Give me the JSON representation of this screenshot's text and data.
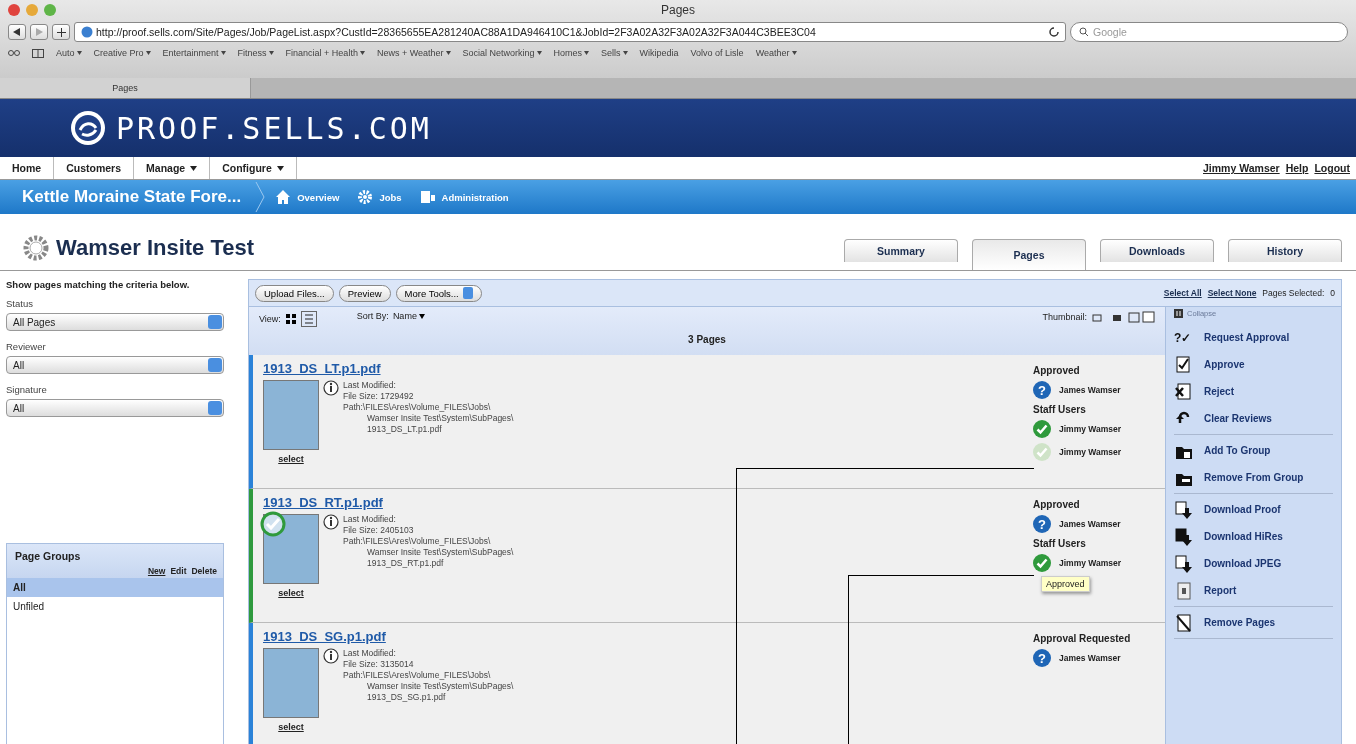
{
  "browser": {
    "title": "Pages",
    "url": "http://proof.sells.com/Site/Pages/Job/PageList.aspx?CustId=28365655EA281240AC88A1DA946410C1&JobId=2F3A02A32F3A02A32F3A044C3BEE3C04",
    "search_placeholder": "Google",
    "bookmarks": [
      {
        "label": "Auto",
        "dropdown": true
      },
      {
        "label": "Creative Pro",
        "dropdown": true
      },
      {
        "label": "Entertainment",
        "dropdown": true
      },
      {
        "label": "Fitness",
        "dropdown": true
      },
      {
        "label": "Financial + Health",
        "dropdown": true
      },
      {
        "label": "News + Weather",
        "dropdown": true
      },
      {
        "label": "Social Networking",
        "dropdown": true
      },
      {
        "label": "Homes",
        "dropdown": true
      },
      {
        "label": "Sells",
        "dropdown": true
      },
      {
        "label": "Wikipedia",
        "dropdown": false
      },
      {
        "label": "Volvo of Lisle",
        "dropdown": false
      },
      {
        "label": "Weather",
        "dropdown": true
      }
    ],
    "tab": "Pages"
  },
  "site": {
    "logo": "PROOF.SELLS.COM"
  },
  "menu": {
    "items": [
      {
        "label": "Home",
        "dropdown": false
      },
      {
        "label": "Customers",
        "dropdown": false
      },
      {
        "label": "Manage",
        "dropdown": true
      },
      {
        "label": "Configure",
        "dropdown": true
      }
    ],
    "user": "Jimmy Wamser",
    "links": [
      "Help",
      "Logout"
    ]
  },
  "breadcrumb": {
    "job": "Kettle Moraine State Fore...",
    "links": [
      {
        "label": "Overview",
        "kind": "home"
      },
      {
        "label": "Jobs",
        "kind": "gear"
      },
      {
        "label": "Administration",
        "kind": "admin"
      }
    ]
  },
  "page_title": "Wamser Insite Test",
  "tabs": [
    {
      "label": "Summary",
      "selected": false
    },
    {
      "label": "Pages",
      "selected": true
    },
    {
      "label": "Downloads",
      "selected": false
    },
    {
      "label": "History",
      "selected": false
    }
  ],
  "filters": {
    "intro": "Show pages matching the criteria below.",
    "fields": [
      {
        "label": "Status",
        "value": "All Pages"
      },
      {
        "label": "Reviewer",
        "value": "All"
      },
      {
        "label": "Signature",
        "value": "All"
      }
    ]
  },
  "page_groups": {
    "title": "Page Groups",
    "actions": [
      "New",
      "Edit",
      "Delete"
    ],
    "items": [
      {
        "label": "All",
        "selected": true
      },
      {
        "label": "Unfiled",
        "selected": false
      }
    ]
  },
  "toolbar": {
    "buttons": [
      "Upload Files...",
      "Preview"
    ],
    "more_tools": "More Tools...",
    "select_links": [
      "Select All",
      "Select None"
    ],
    "selected_label": "Pages Selected:",
    "selected_count": "0"
  },
  "view": {
    "label": "View:",
    "sort_label": "Sort By:",
    "sort_value": "Name",
    "thumbnail_label": "Thumbnail:",
    "count": "3 Pages"
  },
  "pages": [
    {
      "name": "1913_DS_LT.p1.pdf",
      "color": "#2a82d8",
      "approved_badge": false,
      "info": [
        "Last Modified:",
        "File Size: 1729492",
        "Path:\\FILES\\Ares\\Volume_FILES\\Jobs\\",
        "Wamser Insite Test\\System\\SubPages\\",
        "1913_DS_LT.p1.pdf"
      ],
      "select": "select",
      "sections": [
        {
          "heading": "Approved",
          "reviewers": [
            {
              "name": "James Wamser",
              "kind": "pending",
              "icon": "?"
            }
          ]
        },
        {
          "heading": "Staff Users",
          "reviewers": [
            {
              "name": "Jimmy Wamser",
              "kind": "approved"
            },
            {
              "name": "Jimmy Wamser",
              "kind": "faded"
            }
          ]
        }
      ]
    },
    {
      "name": "1913_DS_RT.p1.pdf",
      "color": "#2e9a3e",
      "approved_badge": true,
      "info": [
        "Last Modified:",
        "File Size: 2405103",
        "Path:\\FILES\\Ares\\Volume_FILES\\Jobs\\",
        "Wamser Insite Test\\System\\SubPages\\",
        "1913_DS_RT.p1.pdf"
      ],
      "select": "select",
      "sections": [
        {
          "heading": "Approved",
          "reviewers": [
            {
              "name": "James Wamser",
              "kind": "pending",
              "icon": "?"
            }
          ]
        },
        {
          "heading": "Staff Users",
          "reviewers": [
            {
              "name": "Jimmy Wamser",
              "kind": "approved",
              "tooltip": "Approved"
            }
          ]
        }
      ]
    },
    {
      "name": "1913_DS_SG.p1.pdf",
      "color": "#2a82d8",
      "approved_badge": false,
      "info": [
        "Last Modified:",
        "File Size: 3135014",
        "Path:\\FILES\\Ares\\Volume_FILES\\Jobs\\",
        "Wamser Insite Test\\System\\SubPages\\",
        "1913_DS_SG.p1.pdf"
      ],
      "select": "select",
      "sections": [
        {
          "heading": "Approval Requested",
          "reviewers": [
            {
              "name": "James Wamser",
              "kind": "pending",
              "icon": "?"
            }
          ]
        }
      ]
    }
  ],
  "actions": {
    "collapse": "Collapse",
    "groups": [
      [
        {
          "label": "Request Approval",
          "kind": "request",
          "icon": "?✓"
        },
        {
          "label": "Approve",
          "kind": "approve"
        },
        {
          "label": "Reject",
          "kind": "reject"
        },
        {
          "label": "Clear Reviews",
          "kind": "clear"
        }
      ],
      [
        {
          "label": "Add To Group",
          "kind": "add"
        },
        {
          "label": "Remove From Group",
          "kind": "remove"
        }
      ],
      [
        {
          "label": "Download Proof",
          "kind": "download"
        },
        {
          "label": "Download HiRes",
          "kind": "download"
        },
        {
          "label": "Download JPEG",
          "kind": "download"
        },
        {
          "label": "Report",
          "kind": "report"
        }
      ],
      [
        {
          "label": "Remove Pages",
          "kind": "delete"
        }
      ]
    ]
  }
}
